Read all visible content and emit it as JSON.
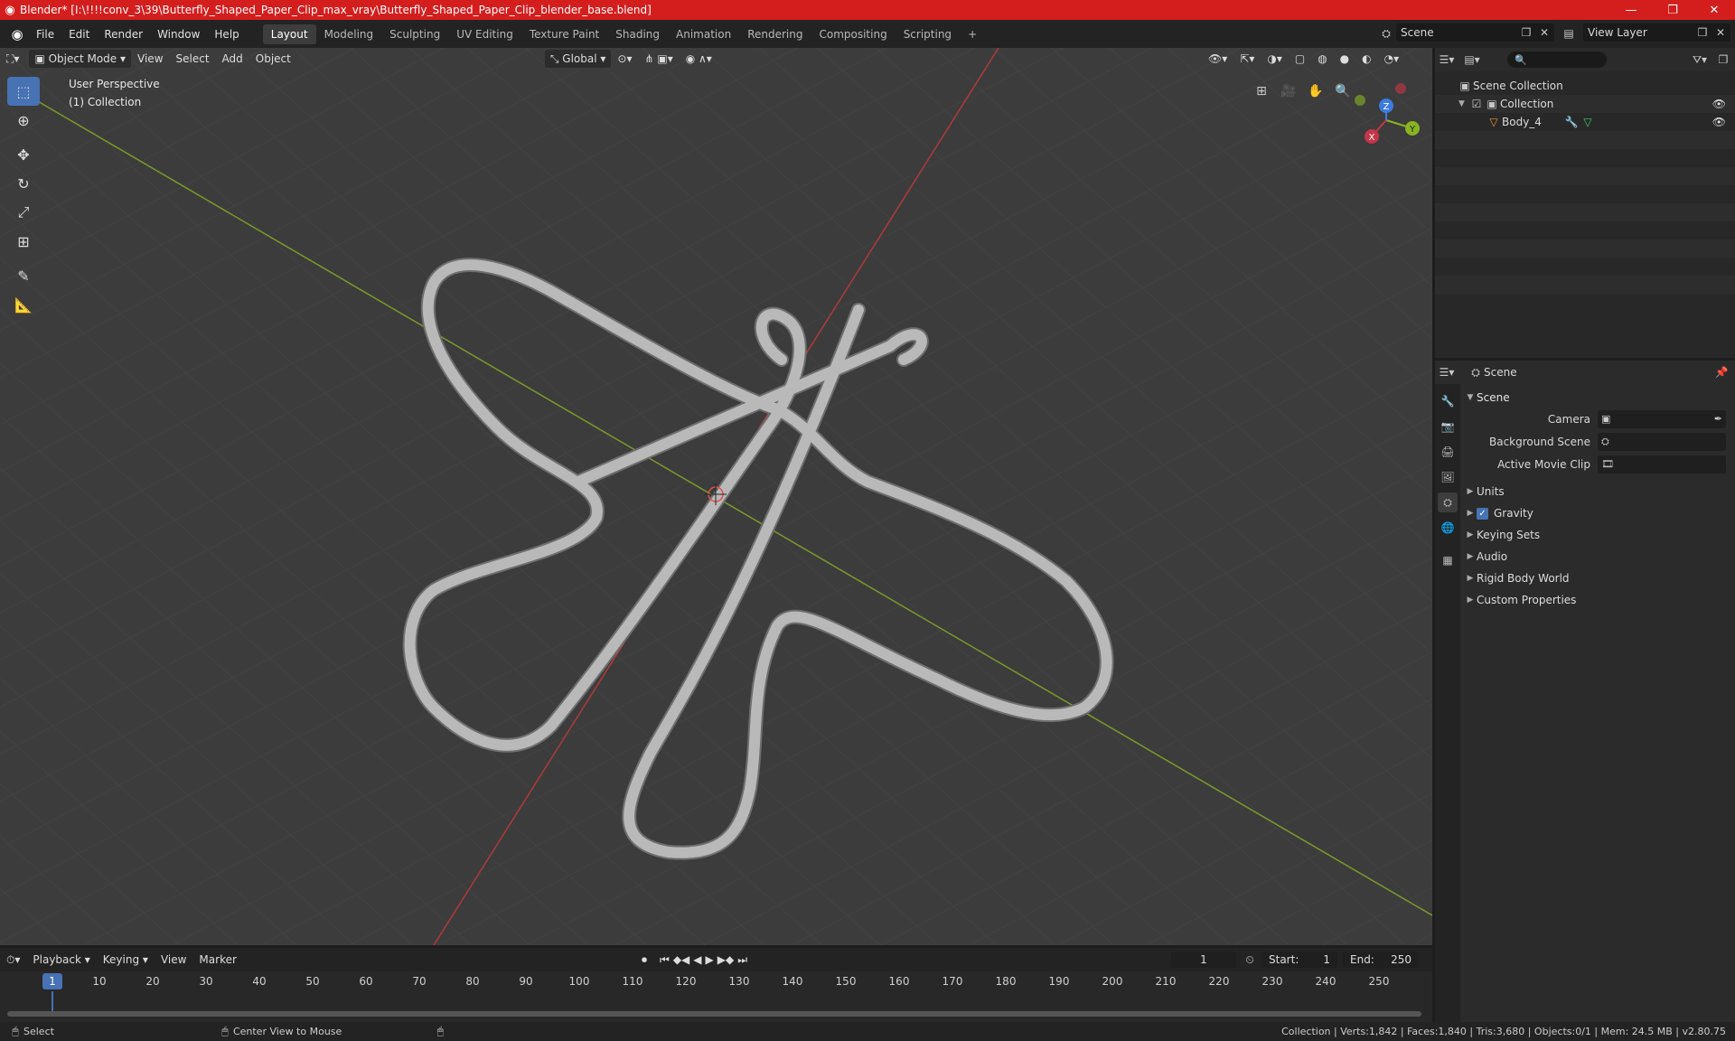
{
  "window": {
    "title": "Blender* [I:\\!!!!conv_3\\39\\Butterfly_Shaped_Paper_Clip_max_vray\\Butterfly_Shaped_Paper_Clip_blender_base.blend]"
  },
  "menu": [
    "File",
    "Edit",
    "Render",
    "Window",
    "Help"
  ],
  "workspaces": [
    "Layout",
    "Modeling",
    "Sculpting",
    "UV Editing",
    "Texture Paint",
    "Shading",
    "Animation",
    "Rendering",
    "Compositing",
    "Scripting"
  ],
  "active_workspace": "Layout",
  "scene_name": "Scene",
  "view_layer_name": "View Layer",
  "viewport": {
    "mode": "Object Mode",
    "menus": [
      "View",
      "Select",
      "Add",
      "Object"
    ],
    "transform_orientation": "Global",
    "info_line1": "User Perspective",
    "info_line2": "(1) Collection",
    "gizmo_axes": {
      "x": "X",
      "y": "Y",
      "z": "Z"
    }
  },
  "outliner": {
    "root": "Scene Collection",
    "collection": "Collection",
    "object": "Body_4"
  },
  "properties": {
    "header": "Scene",
    "panel_title": "Scene",
    "camera_label": "Camera",
    "background_scene_label": "Background Scene",
    "active_movie_clip_label": "Active Movie Clip",
    "subpanels": [
      "Units",
      "Gravity",
      "Keying Sets",
      "Audio",
      "Rigid Body World",
      "Custom Properties"
    ]
  },
  "timeline": {
    "menus": [
      "Playback",
      "Keying",
      "View",
      "Marker"
    ],
    "current_frame": "1",
    "start_label": "Start:",
    "start_value": "1",
    "end_label": "End:",
    "end_value": "250",
    "ruler_current": "1",
    "ticks": [
      "10",
      "20",
      "30",
      "40",
      "50",
      "60",
      "70",
      "80",
      "90",
      "100",
      "110",
      "120",
      "130",
      "140",
      "150",
      "160",
      "170",
      "180",
      "190",
      "200",
      "210",
      "220",
      "230",
      "240",
      "250"
    ]
  },
  "statusbar": {
    "select": "Select",
    "center_view": "Center View to Mouse",
    "stats": "Collection | Verts:1,842 | Faces:1,840 | Tris:3,680 | Objects:0/1 | Mem: 24.5 MB | v2.80.75"
  },
  "colors": {
    "accent": "#4772b3",
    "titlebar": "#d41e1e",
    "x_axis": "#c6354a",
    "y_axis": "#8ab321",
    "z_axis": "#3d7be0"
  }
}
